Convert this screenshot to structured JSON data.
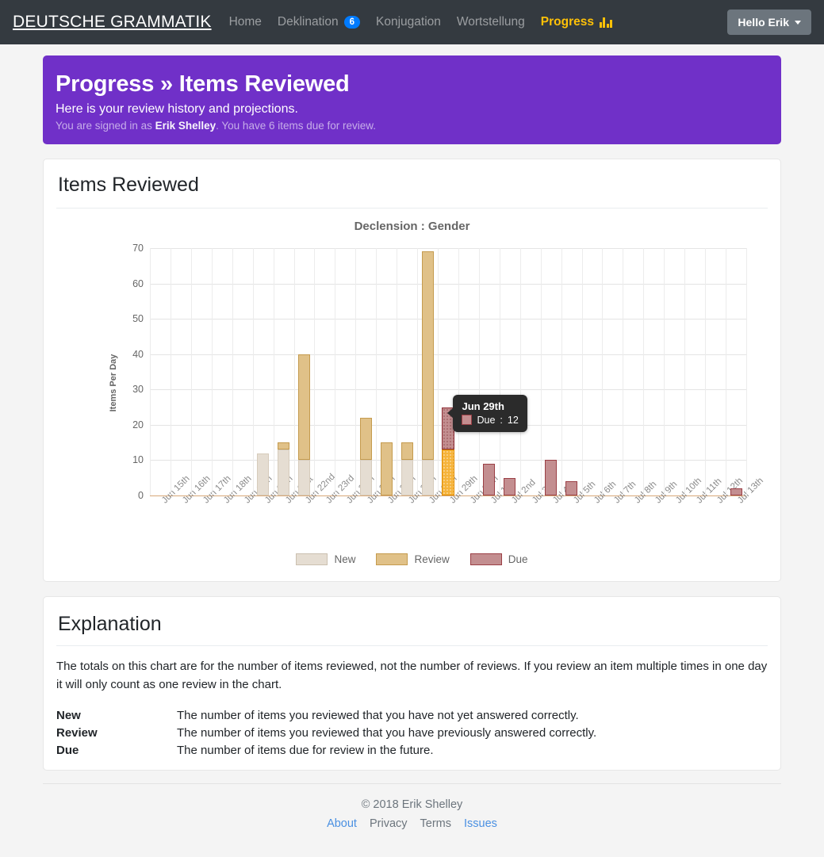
{
  "navbar": {
    "brand": "DEUTSCHE GRAMMATIK",
    "links": [
      {
        "label": "Home",
        "badge": null,
        "active": false,
        "icon": null
      },
      {
        "label": "Deklination",
        "badge": "6",
        "active": false,
        "icon": null
      },
      {
        "label": "Konjugation",
        "badge": null,
        "active": false,
        "icon": null
      },
      {
        "label": "Wortstellung",
        "badge": null,
        "active": false,
        "icon": null
      },
      {
        "label": "Progress",
        "badge": null,
        "active": true,
        "icon": "bar-chart-icon"
      }
    ],
    "user_button": "Hello Erik",
    "badge_color": "#007bff",
    "active_color": "#ffc107"
  },
  "jumbotron": {
    "title": "Progress » Items Reviewed",
    "lead": "Here is your review history and projections.",
    "signed_prefix": "You are signed in as ",
    "signed_user": "Erik Shelley",
    "signed_suffix": ". You have 6 items due for review.",
    "bg": "#7030c8"
  },
  "chart_card": {
    "title": "Items Reviewed"
  },
  "chart_data": {
    "type": "bar",
    "stacked": true,
    "title": "Declension : Gender",
    "xlabel": "",
    "ylabel": "Items Per Day",
    "ylim": [
      0,
      70
    ],
    "yticks": [
      0,
      10,
      20,
      30,
      40,
      50,
      60,
      70
    ],
    "grid": true,
    "legend_position": "bottom",
    "categories": [
      "Jun 15th",
      "Jun 16th",
      "Jun 17th",
      "Jun 18th",
      "Jun 19th",
      "Jun 20th",
      "Jun 21st",
      "Jun 22nd",
      "Jun 23rd",
      "Jun 24th",
      "Jun 25th",
      "Jun 26th",
      "Jun 27th",
      "Jun 28th",
      "Jun 29th",
      "Jun 30th",
      "Jul 1st",
      "Jul 2nd",
      "Jul 3rd",
      "Jul 4th",
      "Jul 5th",
      "Jul 6th",
      "Jul 7th",
      "Jul 8th",
      "Jul 9th",
      "Jul 10th",
      "Jul 11th",
      "Jul 12th",
      "Jul 13th"
    ],
    "series": [
      {
        "name": "New",
        "color": "#e5ddd2",
        "border": "#cbc0b0",
        "values": [
          0,
          0,
          0,
          0,
          0,
          12,
          13,
          10,
          0,
          0,
          10,
          0,
          10,
          10,
          0,
          0,
          0,
          0,
          0,
          0,
          0,
          0,
          0,
          0,
          0,
          0,
          0,
          0,
          0
        ]
      },
      {
        "name": "Review",
        "color": "#e0c188",
        "border": "#c59b4e",
        "values": [
          0,
          0,
          0,
          0,
          0,
          0,
          2,
          30,
          0,
          0,
          12,
          15,
          5,
          59,
          13,
          0,
          0,
          0,
          0,
          0,
          0,
          0,
          0,
          0,
          0,
          0,
          0,
          0,
          0
        ]
      },
      {
        "name": "Due",
        "color": "#c38e90",
        "border": "#9b3f45",
        "values": [
          0,
          0,
          0,
          0,
          0,
          0,
          0,
          0,
          0,
          0,
          0,
          0,
          0,
          0,
          12,
          0,
          9,
          5,
          0,
          10,
          4,
          0,
          0,
          0,
          0,
          0,
          0,
          0,
          2
        ]
      }
    ],
    "totals": [
      0,
      0,
      0,
      0,
      0,
      12,
      15,
      40,
      0,
      0,
      22,
      15,
      15,
      69,
      25,
      0,
      9,
      5,
      0,
      10,
      4,
      0,
      0,
      0,
      0,
      0,
      0,
      0,
      2
    ],
    "highlighted_index": 14,
    "tooltip": {
      "title": "Jun 29th",
      "series_label": "Due",
      "separator": ":",
      "value": "12"
    }
  },
  "explanation": {
    "title": "Explanation",
    "paragraph": "The totals on this chart are for the number of items reviewed, not the number of reviews. If you review an item multiple times in one day it will only count as one review in the chart.",
    "terms": [
      {
        "term": "New",
        "definition": "The number of items you reviewed that you have not yet answered correctly."
      },
      {
        "term": "Review",
        "definition": "The number of items you reviewed that you have previously answered correctly."
      },
      {
        "term": "Due",
        "definition": "The number of items due for review in the future."
      }
    ]
  },
  "footer": {
    "copyright": "© 2018 Erik Shelley",
    "links": [
      {
        "label": "About",
        "style": "blue"
      },
      {
        "label": "Privacy",
        "style": "gray"
      },
      {
        "label": "Terms",
        "style": "gray"
      },
      {
        "label": "Issues",
        "style": "blue"
      }
    ]
  }
}
